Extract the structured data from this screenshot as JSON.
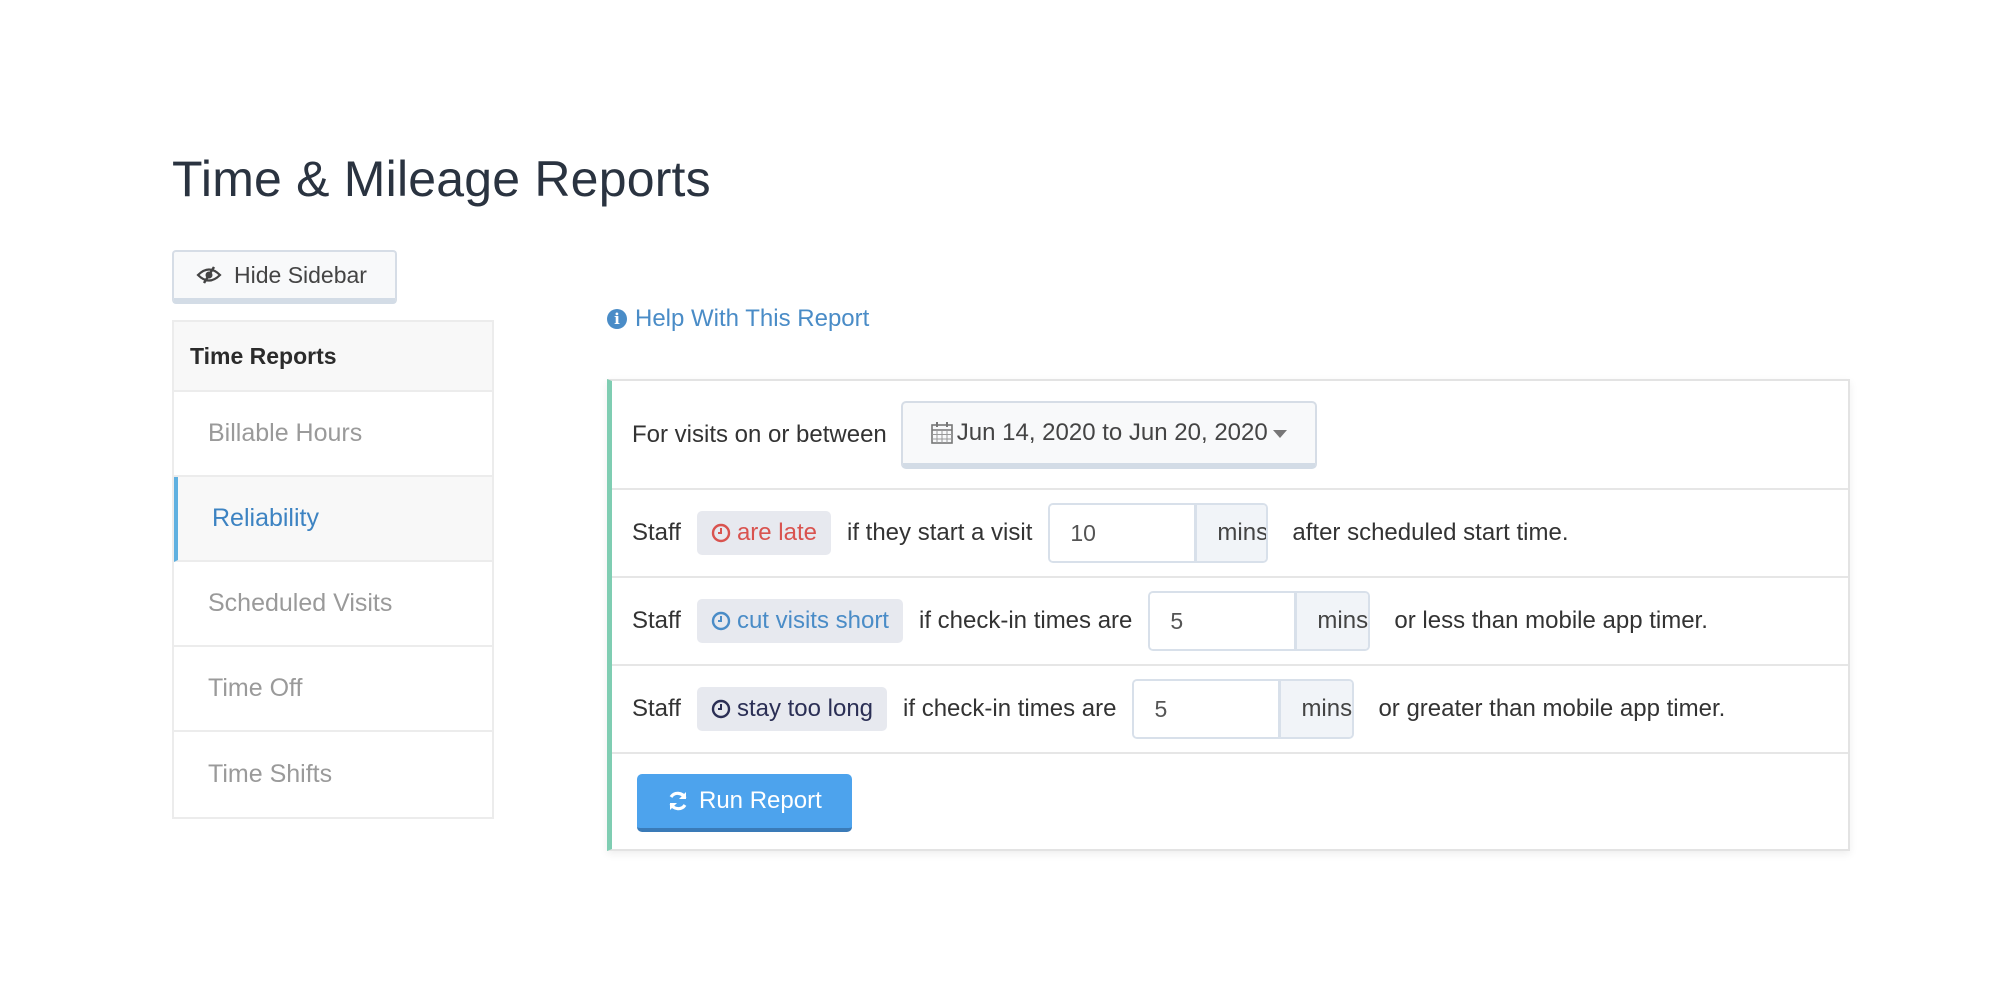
{
  "page": {
    "title": "Time & Mileage Reports"
  },
  "hide_sidebar": {
    "label": "Hide Sidebar",
    "icon": "eye-slash-icon"
  },
  "sidebar": {
    "heading": "Time Reports",
    "items": [
      {
        "label": "Billable Hours",
        "active": false
      },
      {
        "label": "Reliability",
        "active": true
      },
      {
        "label": "Scheduled Visits",
        "active": false
      },
      {
        "label": "Time Off",
        "active": false
      },
      {
        "label": "Time Shifts",
        "active": false
      }
    ]
  },
  "help": {
    "label": "Help With This Report",
    "icon": "info-circle-icon"
  },
  "form": {
    "date_row": {
      "label": "For visits on or between",
      "range": "Jun 14, 2020 to Jun 20, 2020",
      "icon": "calendar-icon"
    },
    "rules": [
      {
        "prefix": "Staff",
        "tag": "are late",
        "tag_color": "#d9534f",
        "condition": "if they start a visit",
        "value": "10",
        "unit": "mins",
        "suffix": "after scheduled start time."
      },
      {
        "prefix": "Staff",
        "tag": "cut visits short",
        "tag_color": "#4a8cc7",
        "condition": "if check-in times are",
        "value": "5",
        "unit": "mins",
        "suffix": "or less than mobile app timer."
      },
      {
        "prefix": "Staff",
        "tag": "stay too long",
        "tag_color": "#2b2f55",
        "condition": "if check-in times are",
        "value": "5",
        "unit": "mins",
        "suffix": "or greater than mobile app timer."
      }
    ],
    "run_button": {
      "label": "Run Report",
      "icon": "refresh-icon"
    }
  },
  "colors": {
    "accent": "#4da3ed",
    "panel_border_left": "#7fcdb2",
    "active_sidebar": "#3d83c2"
  }
}
